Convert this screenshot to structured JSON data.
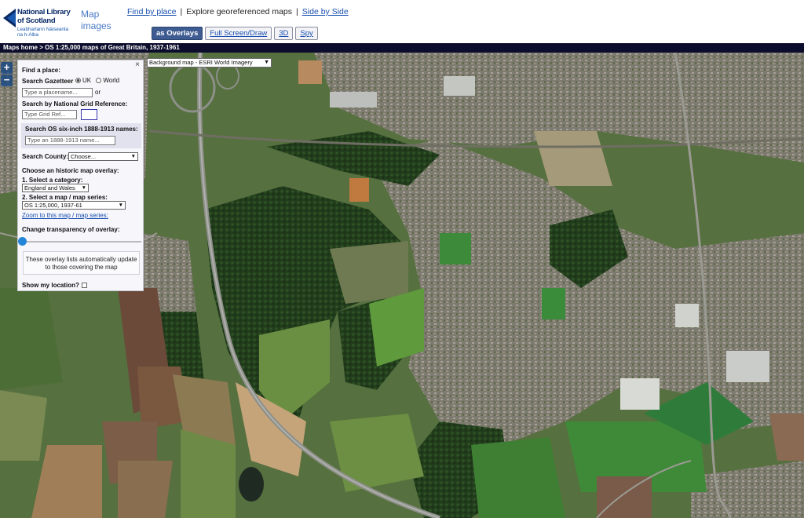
{
  "logo": {
    "line1": "National Library",
    "line2": "of Scotland",
    "line3": "Leabharlann Nàiseanta",
    "line4": "na h-Alba"
  },
  "app_title": "Map images",
  "top_nav": {
    "find_by_place": "Find by place",
    "explore": "Explore georeferenced maps",
    "side_by_side": "Side by Side",
    "separator": "|"
  },
  "view_buttons": [
    "as Overlays",
    "Full Screen/Draw",
    "3D",
    "Spy"
  ],
  "breadcrumb": "Maps home  >  OS 1:25,000 maps of Great Britain, 1937-1961",
  "map": {
    "zoom_in": "+",
    "zoom_out": "−",
    "background_select": "Background map - ESRI World Imagery"
  },
  "find_panel": {
    "close": "×",
    "title": "Find a place:",
    "gazetteer_label": "Search Gazetteer",
    "radio_uk": "UK",
    "radio_world": "World",
    "placename_placeholder": "Type a placename...",
    "or": "or",
    "grid_label": "Search by National Grid Reference:",
    "grid_placeholder": "Type Grid Ref...",
    "six_inch_label": "Search OS six-inch 1888-1913 names:",
    "six_inch_placeholder": "Type an 1888-1913 name...",
    "county_label": "Search County:",
    "county_value": "Choose...",
    "overlay_title": "Choose an historic map overlay:",
    "category_label": "1. Select a category:",
    "category_value": "England and Wales",
    "series_label": "2. Select a map / map series:",
    "series_value": "OS 1:25,000, 1937-61",
    "zoom_link": "Zoom to this map / map series:",
    "transparency_label": "Change transparency of overlay:",
    "transparency_value": 0,
    "overlay_note": "These overlay lists automatically update to those covering the map",
    "location_label": "Show my location?"
  },
  "colors": {
    "active_button": "#3e5c91",
    "breadcrumb_bg": "#0c0c2c",
    "link": "#1a4fb0",
    "slider_knob": "#2386d8"
  }
}
